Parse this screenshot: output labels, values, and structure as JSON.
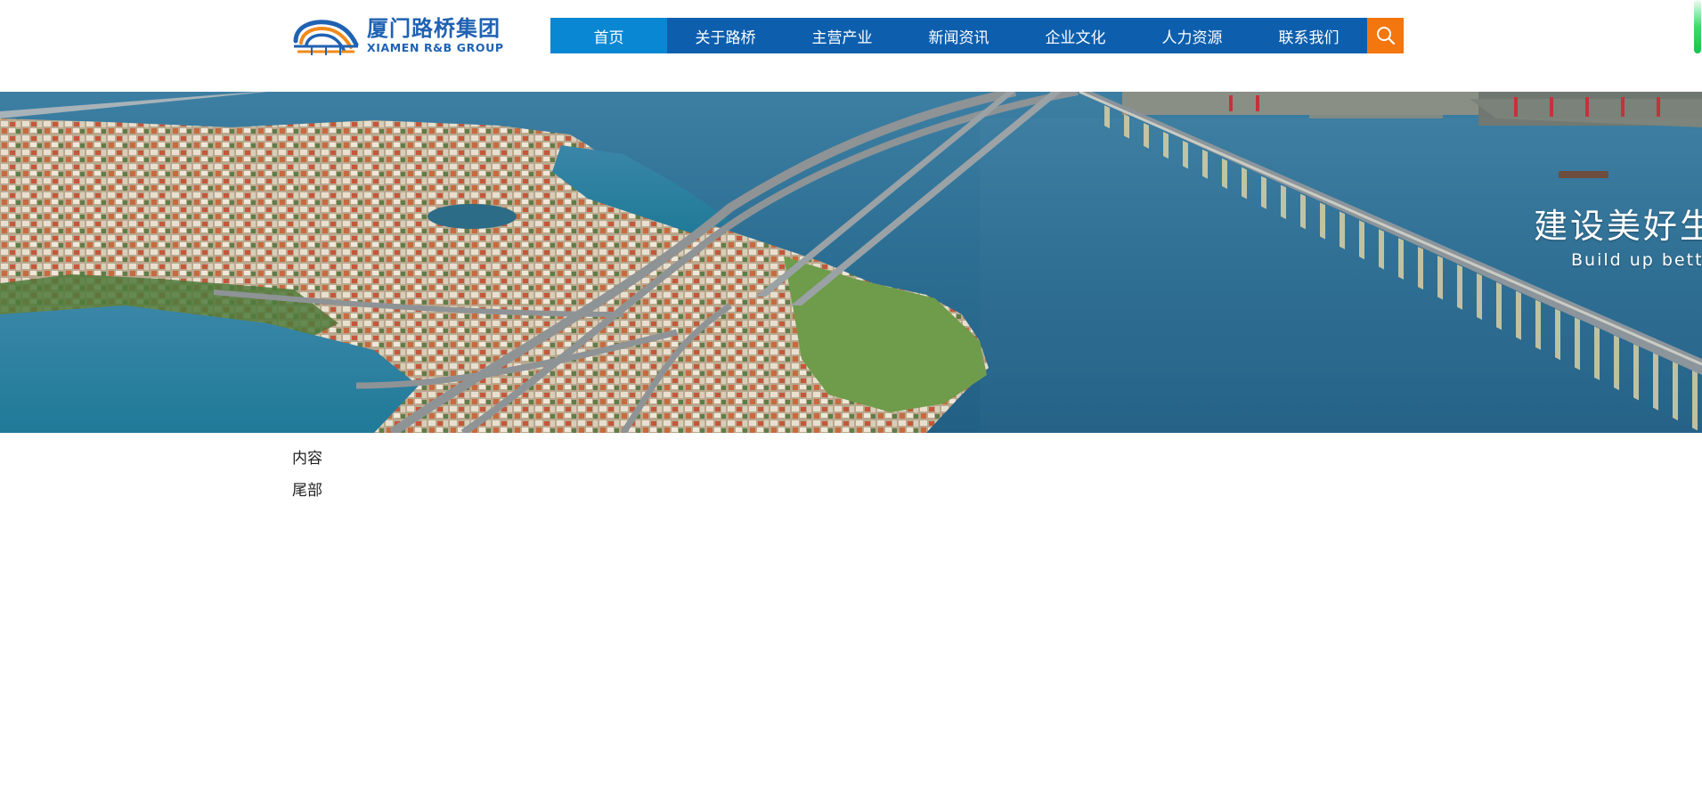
{
  "header": {
    "logo": {
      "name_cn": "厦门路桥集团",
      "name_en": "XIAMEN R&B GROUP",
      "colors": {
        "blue": "#1f62b2",
        "orange": "#f08a1c"
      }
    },
    "nav": {
      "items": [
        {
          "label": "首页",
          "active": true
        },
        {
          "label": "关于路桥",
          "active": false
        },
        {
          "label": "主营产业",
          "active": false
        },
        {
          "label": "新闻资讯",
          "active": false
        },
        {
          "label": "企业文化",
          "active": false
        },
        {
          "label": "人力资源",
          "active": false
        },
        {
          "label": "联系我们",
          "active": false
        }
      ],
      "colors": {
        "background": "#0d5fae",
        "active": "#0a87d2"
      }
    },
    "search": {
      "icon": "search-icon",
      "color": "#f3760e"
    }
  },
  "banner": {
    "slogan_cn": "建设美好生",
    "slogan_en": "Build up better",
    "image": "aerial-city-bridges"
  },
  "main": {
    "content_label": "内容",
    "footer_label": "尾部"
  }
}
